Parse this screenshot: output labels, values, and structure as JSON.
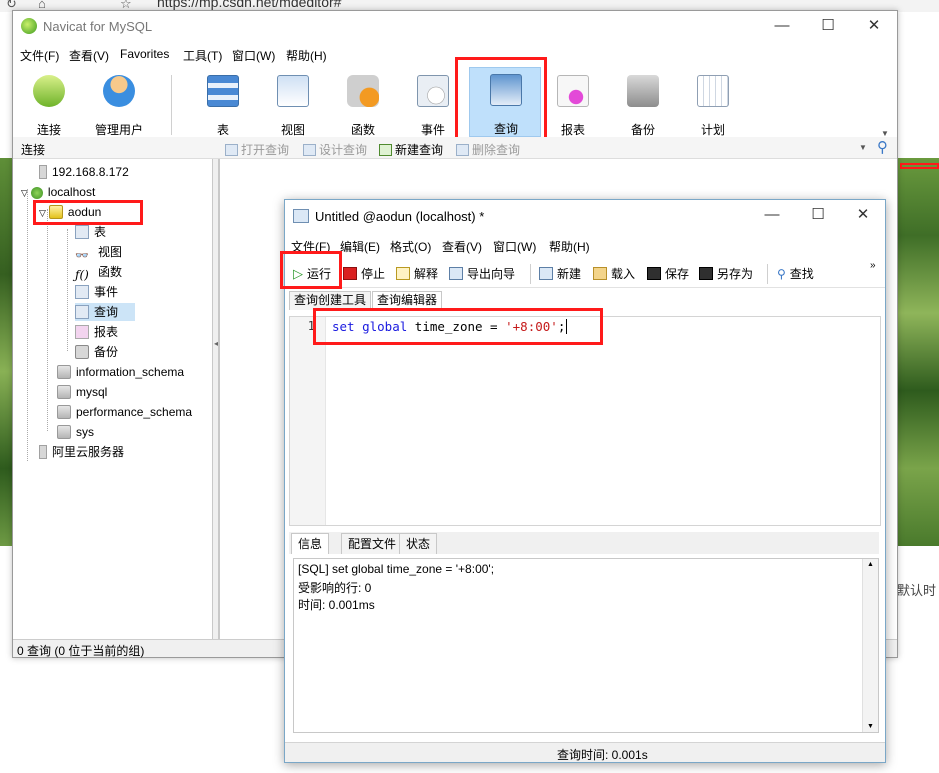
{
  "browser": {
    "url": "https://mp.csdn.net/mdeditor#",
    "right_side_text": "默认时"
  },
  "main_window": {
    "title": "Navicat for MySQL",
    "menu": [
      "文件(F)",
      "查看(V)",
      "Favorites",
      "工具(T)",
      "窗口(W)",
      "帮助(H)"
    ],
    "toolbar": [
      {
        "label": "连接",
        "icon": "connection-icon"
      },
      {
        "label": "管理用户",
        "icon": "user-icon"
      },
      {
        "label": "表",
        "icon": "table-icon"
      },
      {
        "label": "视图",
        "icon": "view-icon"
      },
      {
        "label": "函数",
        "icon": "function-icon"
      },
      {
        "label": "事件",
        "icon": "event-icon"
      },
      {
        "label": "查询",
        "icon": "query-icon"
      },
      {
        "label": "报表",
        "icon": "report-icon"
      },
      {
        "label": "备份",
        "icon": "backup-icon"
      },
      {
        "label": "计划",
        "icon": "schedule-icon"
      }
    ],
    "subbar": {
      "section_label": "连接",
      "open_query": "打开查询",
      "design_query": "设计查询",
      "new_query": "新建查询",
      "delete_query": "删除查询"
    },
    "tree": [
      {
        "label": "192.168.8.172",
        "level": 0
      },
      {
        "label": "localhost",
        "level": 0
      },
      {
        "label": "aodun",
        "level": 1
      },
      {
        "label": "表",
        "level": 2
      },
      {
        "label": "视图",
        "level": 2
      },
      {
        "label": "函数",
        "level": 2
      },
      {
        "label": "事件",
        "level": 2
      },
      {
        "label": "查询",
        "level": 2
      },
      {
        "label": "报表",
        "level": 2
      },
      {
        "label": "备份",
        "level": 2
      },
      {
        "label": "information_schema",
        "level": 1
      },
      {
        "label": "mysql",
        "level": 1
      },
      {
        "label": "performance_schema",
        "level": 1
      },
      {
        "label": "sys",
        "level": 1
      },
      {
        "label": "阿里云服务器",
        "level": 0
      }
    ],
    "status": "0 查询 (0 位于当前的组)"
  },
  "query_window": {
    "title": "Untitled @aodun (localhost) *",
    "menu": [
      "文件(F)",
      "编辑(E)",
      "格式(O)",
      "查看(V)",
      "窗口(W)",
      "帮助(H)"
    ],
    "toolbar": {
      "run": "运行",
      "stop": "停止",
      "explain": "解释",
      "export_wizard": "导出向导",
      "new": "新建",
      "load": "载入",
      "save": "保存",
      "save_as": "另存为",
      "find": "查找"
    },
    "tabs": [
      "查询创建工具",
      "查询编辑器"
    ],
    "editor": {
      "line_number": "1",
      "code_kw1": "set",
      "code_kw2": "global",
      "code_ident": "time_zone =",
      "code_string": "'+8:00'",
      "code_end": ";"
    },
    "result_tabs": [
      "信息",
      "配置文件",
      "状态"
    ],
    "result_lines": [
      "[SQL] set global time_zone = '+8:00';",
      "受影响的行: 0",
      "时间: 0.001ms"
    ],
    "status": "查询时间: 0.001s"
  },
  "colors": {
    "highlight_red": "#ff1a1a",
    "keyword_blue": "#1a1ae0",
    "string_red": "#c51a1a",
    "active_button_bg": "#bfe0fb"
  }
}
